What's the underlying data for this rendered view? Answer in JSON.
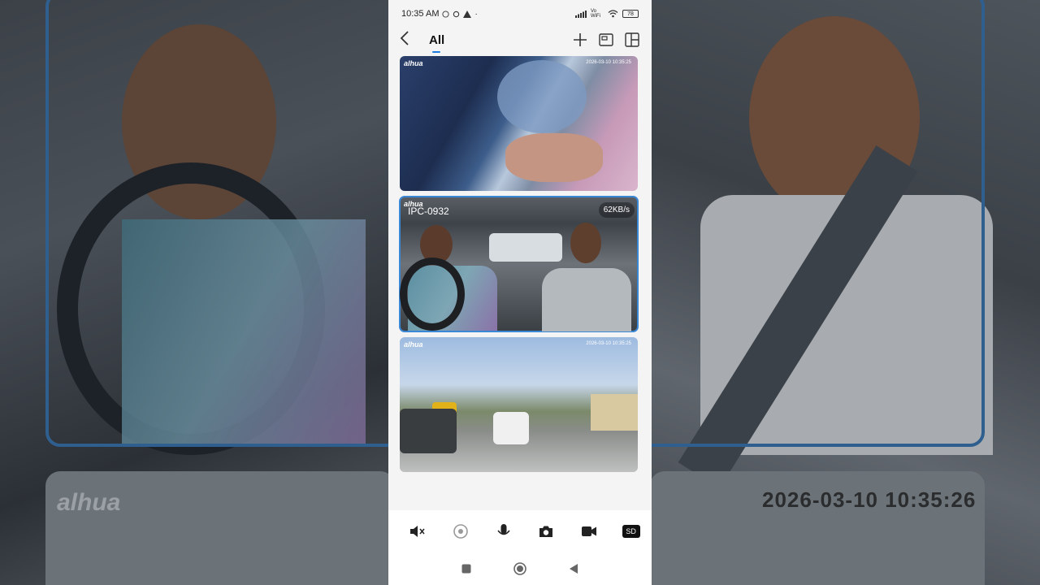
{
  "status_bar": {
    "time": "10:35 AM",
    "network_label": "Vo WiFi",
    "battery": "78"
  },
  "header": {
    "title": "All"
  },
  "feeds": [
    {
      "brand": "alhua",
      "timestamp": "2026-03-10 10:35:25",
      "name": "",
      "speed": ""
    },
    {
      "brand": "alhua",
      "timestamp": "2026-03-10 10:35:26",
      "name": "IPC-0932",
      "speed": "62KB/s"
    },
    {
      "brand": "alhua",
      "timestamp": "2026-03-10 10:35:25",
      "name": "",
      "speed": ""
    }
  ],
  "toolbar": {
    "sd_label": "SD"
  },
  "background": {
    "brand": "alhua",
    "timestamp": "2026-03-10 10:35:26"
  },
  "colors": {
    "accent": "#1d7ae0",
    "selected_border": "#3a87d6"
  }
}
